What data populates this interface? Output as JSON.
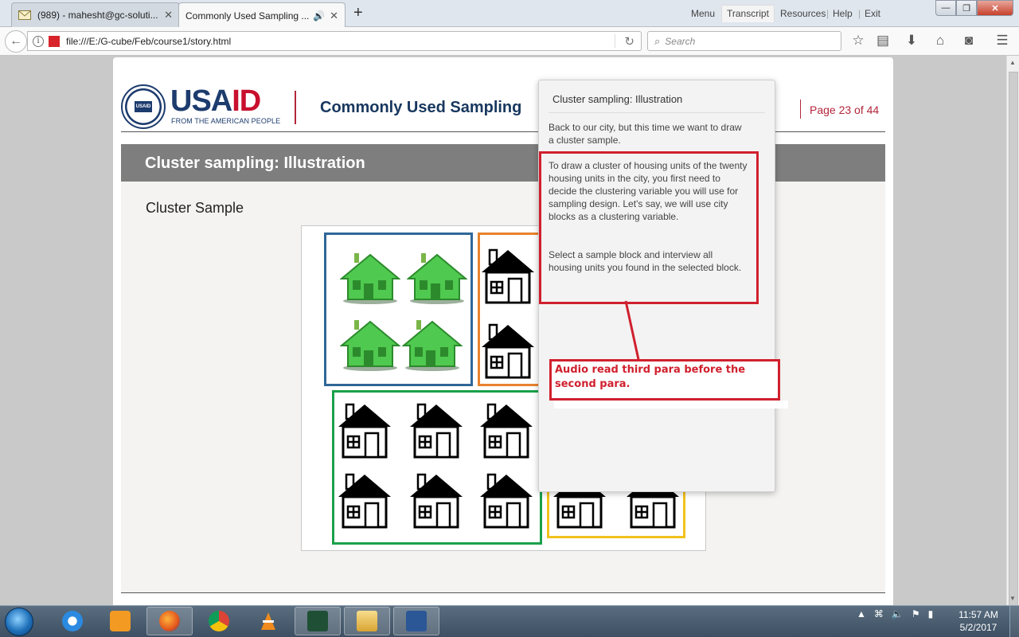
{
  "browser": {
    "tabs": [
      {
        "label": "(989) - mahesht@gc-soluti...",
        "active": false,
        "icon": "mail-icon"
      },
      {
        "label": "Commonly Used Sampling ...",
        "active": true,
        "icon": "speaker-icon"
      }
    ],
    "url": "file:///E:/G-cube/Feb/course1/story.html",
    "search_placeholder": "Search"
  },
  "player": {
    "menu": [
      "Menu",
      "Transcript",
      "Resources",
      "Help",
      "Exit"
    ],
    "active_menu": "Transcript",
    "logo": {
      "wordmark": "USAID",
      "tagline": "FROM THE AMERICAN PEOPLE",
      "seal_text": "USAID"
    },
    "course_title": "Commonly Used Sampling",
    "page_indicator": "Page 23 of  44"
  },
  "slide": {
    "title": "Cluster sampling: Illustration",
    "subtitle": "Cluster Sample"
  },
  "transcript": {
    "title": "Cluster sampling: Illustration",
    "paragraphs": [
      "Back to our city, but this time we want to draw a cluster sample.",
      "To draw a cluster of housing units of the twenty housing units in the city, you first need to decide the clustering variable you will use for sampling design. Let's say, we will use city blocks as a clustering variable.",
      "Select a sample block and interview all housing units you found in the selected block."
    ]
  },
  "annotation": {
    "note": "Audio read third para before the second para."
  },
  "colors": {
    "accent_red": "#b3263a",
    "annotation_red": "#d0202e",
    "usaid_blue": "#1d3c6e",
    "block_blue": "#2f6797",
    "block_orange": "#e8822e",
    "block_green": "#1aa04a",
    "block_yellow": "#f2c21c",
    "house_green": "#4fc94f"
  },
  "taskbar": {
    "apps": [
      "ie-icon",
      "media-icon",
      "firefox-icon",
      "chrome-icon",
      "vlc-icon",
      "storyline-icon",
      "explorer-icon",
      "word-icon"
    ],
    "time": "11:57 AM",
    "date": "5/2/2017"
  }
}
